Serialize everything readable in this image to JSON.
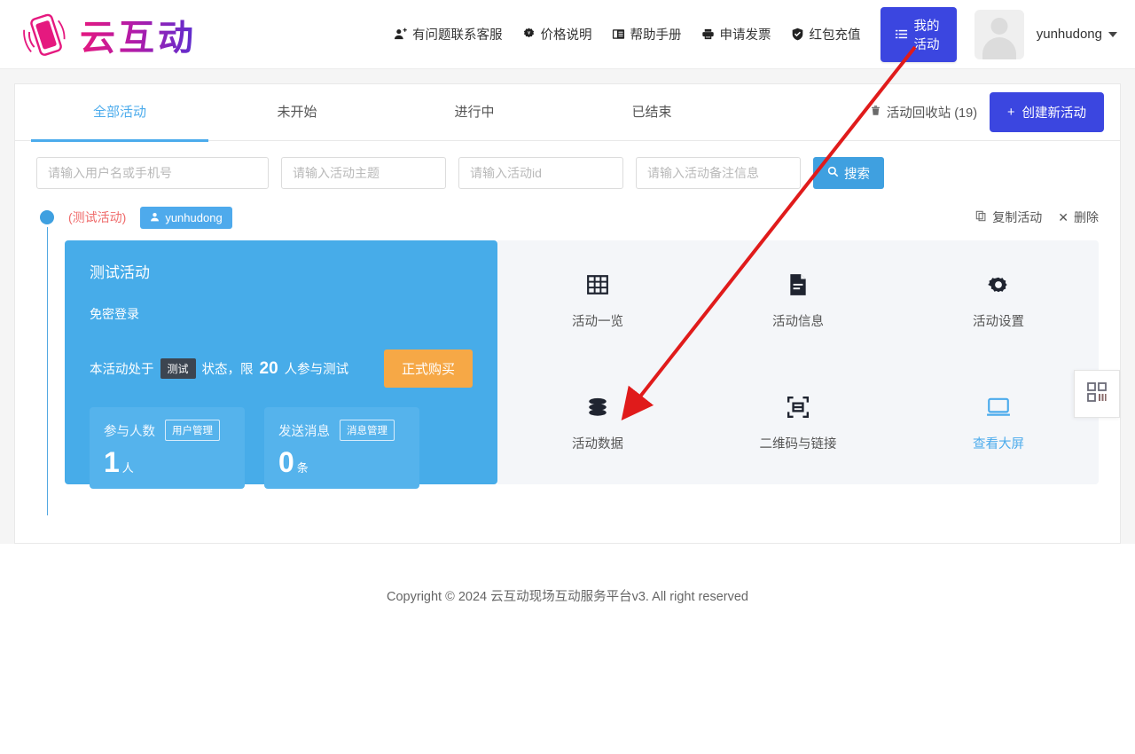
{
  "brand": {
    "name": "云互动"
  },
  "header": {
    "nav": [
      {
        "label": "有问题联系客服",
        "icon": "user-plus-icon"
      },
      {
        "label": "价格说明",
        "icon": "price-tag-icon"
      },
      {
        "label": "帮助手册",
        "icon": "book-icon"
      },
      {
        "label": "申请发票",
        "icon": "printer-icon"
      },
      {
        "label": "红包充值",
        "icon": "shield-check-icon"
      }
    ],
    "my_activities_button": {
      "label": "我的活动",
      "icon": "list-icon",
      "color": "#3b46e0"
    },
    "user": {
      "name": "yunhudong"
    }
  },
  "tabs": [
    {
      "label": "全部活动",
      "active": true
    },
    {
      "label": "未开始",
      "active": false
    },
    {
      "label": "进行中",
      "active": false
    },
    {
      "label": "已结束",
      "active": false
    }
  ],
  "recycle_bin": {
    "label": "活动回收站 (19)",
    "icon": "trash-icon"
  },
  "create_button": {
    "label": "创建新活动",
    "icon": "plus-icon"
  },
  "search": {
    "fields": [
      {
        "placeholder": "请输入用户名或手机号",
        "value": ""
      },
      {
        "placeholder": "请输入活动主题",
        "value": ""
      },
      {
        "placeholder": "请输入活动id",
        "value": ""
      },
      {
        "placeholder": "请输入活动备注信息",
        "value": ""
      }
    ],
    "button": {
      "label": "搜索",
      "icon": "search-icon"
    }
  },
  "activity": {
    "test_tag": "(测试活动)",
    "owner_badge": "yunhudong",
    "actions": [
      {
        "label": "复制活动",
        "icon": "copy-icon"
      },
      {
        "label": "删除",
        "icon": "close-icon"
      }
    ],
    "title": "测试活动",
    "subtitle": "免密登录",
    "status_prefix": "本活动处于",
    "status_chip": "测试",
    "status_mid": "状态，限",
    "status_limit": "20",
    "status_suffix": "人参与测试",
    "buy_button": "正式购买",
    "stats": [
      {
        "label": "参与人数",
        "action": "用户管理",
        "value": "1",
        "unit": "人"
      },
      {
        "label": "发送消息",
        "action": "消息管理",
        "value": "0",
        "unit": "条"
      }
    ],
    "tools": [
      {
        "label": "活动一览",
        "icon": "grid-icon",
        "accent": false
      },
      {
        "label": "活动信息",
        "icon": "document-icon",
        "accent": false
      },
      {
        "label": "活动设置",
        "icon": "gear-icon",
        "accent": false
      },
      {
        "label": "活动数据",
        "icon": "database-icon",
        "accent": false
      },
      {
        "label": "二维码与链接",
        "icon": "scan-icon",
        "accent": false
      },
      {
        "label": "查看大屏",
        "icon": "monitor-icon",
        "accent": true
      }
    ]
  },
  "side_tab": {
    "icon": "qrcode-icon"
  },
  "footer": {
    "text": "Copyright © 2024 云互动现场互动服务平台v3. All right reserved"
  },
  "annotation": {
    "color": "#e01b1b",
    "from": [
      1032,
      53
    ],
    "to": [
      718,
      452
    ]
  }
}
